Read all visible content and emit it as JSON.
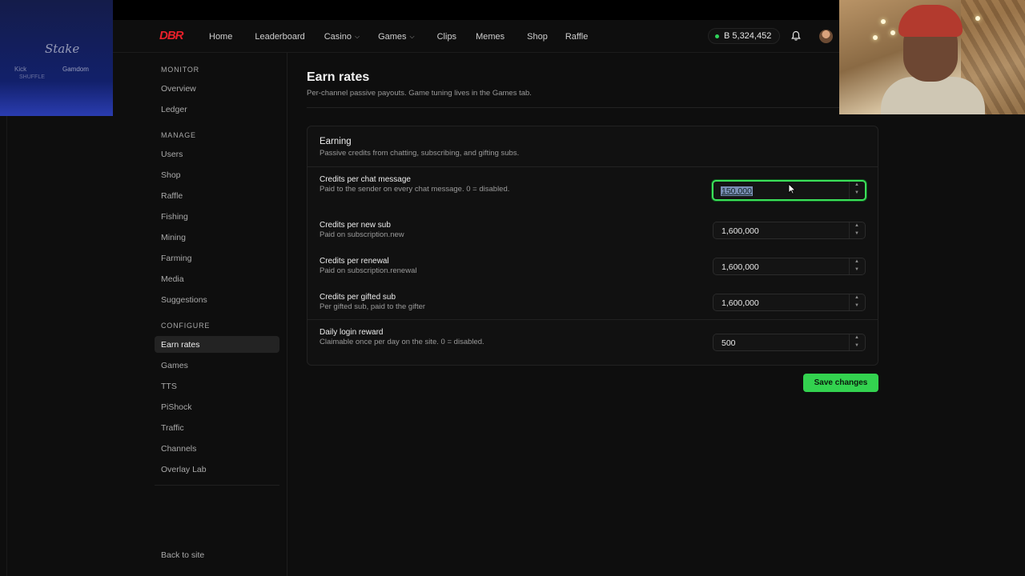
{
  "overlay": {
    "sponsor_logo": "Stake",
    "sponsor_line_left": "Kick",
    "sponsor_line_right": "Gamdom",
    "sponsor_line_sub": "SHUFFLE"
  },
  "header": {
    "brand": "DBR",
    "nav": [
      {
        "label": "Home",
        "dropdown": false
      },
      {
        "label": "Leaderboard",
        "dropdown": false
      },
      {
        "label": "Casino",
        "dropdown": true
      },
      {
        "label": "Games",
        "dropdown": true
      },
      {
        "label": "Clips",
        "dropdown": false
      },
      {
        "label": "Memes",
        "dropdown": false
      },
      {
        "label": "Shop",
        "dropdown": false
      },
      {
        "label": "Raffle",
        "dropdown": false
      }
    ],
    "balance": "B 5,324,452",
    "balance_dot_color": "#2fd35a"
  },
  "sidebar": {
    "sections": [
      {
        "title": "MONITOR",
        "items": [
          "Overview",
          "Ledger"
        ]
      },
      {
        "title": "MANAGE",
        "items": [
          "Users",
          "Shop",
          "Raffle",
          "Fishing",
          "Mining",
          "Farming",
          "Media",
          "Suggestions"
        ]
      },
      {
        "title": "CONFIGURE",
        "items": [
          "Earn rates",
          "Games",
          "TTS",
          "PiShock",
          "Traffic",
          "Channels",
          "Overlay Lab"
        ]
      }
    ],
    "active_item": "Earn rates",
    "back_label": "Back to site"
  },
  "main": {
    "title": "Earn rates",
    "subtitle": "Per-channel passive payouts. Game tuning lives in the Games tab.",
    "card": {
      "title": "Earning",
      "subtitle": "Passive credits from chatting, subscribing, and gifting subs.",
      "rows": [
        {
          "label": "Credits per chat message",
          "help": "Paid to the sender on every chat message. 0 = disabled.",
          "value": "150,000",
          "focused": true
        },
        {
          "label": "Credits per new sub",
          "help": "Paid on subscription.new",
          "value": "1,600,000",
          "focused": false
        },
        {
          "label": "Credits per renewal",
          "help": "Paid on subscription.renewal",
          "value": "1,600,000",
          "focused": false
        },
        {
          "label": "Credits per gifted sub",
          "help": "Per gifted sub, paid to the gifter",
          "value": "1,600,000",
          "focused": false
        },
        {
          "label": "Daily login reward",
          "help": "Claimable once per day on the site. 0 = disabled.",
          "value": "500",
          "focused": false
        }
      ]
    },
    "save_label": "Save changes",
    "accent_color": "#33d24f"
  }
}
